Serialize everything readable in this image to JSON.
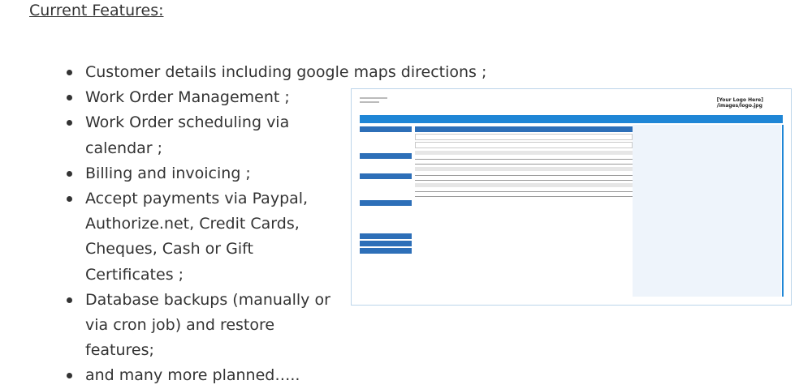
{
  "heading": "Current Features:",
  "features": [
    "Customer details including google maps directions ;",
    "Work Order Management ;",
    "Work Order scheduling via calendar ;",
    "Billing and invoicing ;",
    "Accept payments via Paypal, Authorize.net, Credit Cards, Cheques, Cash or Gift Certificates ;",
    "Database backups (manually or via cron job) and restore features;",
    "and many more planned….."
  ],
  "thumbnail": {
    "logo_line1": "[Your Logo Here]",
    "logo_line2": "/images/logo.jpg",
    "header_color": "#1f86d6"
  }
}
